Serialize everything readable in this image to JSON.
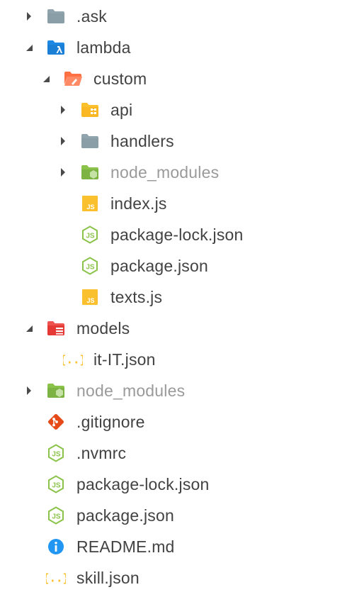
{
  "tree": {
    "items": [
      {
        "name": ".ask",
        "depth": 0,
        "twisty": "collapsed",
        "icon": "folder-grey-icon",
        "dim": false
      },
      {
        "name": "lambda",
        "depth": 0,
        "twisty": "expanded",
        "icon": "folder-lambda-blue-icon",
        "dim": false
      },
      {
        "name": "custom",
        "depth": 1,
        "twisty": "expanded",
        "icon": "folder-open-orange-icon",
        "dim": false
      },
      {
        "name": "api",
        "depth": 2,
        "twisty": "collapsed",
        "icon": "folder-api-yellow-icon",
        "dim": false
      },
      {
        "name": "handlers",
        "depth": 2,
        "twisty": "collapsed",
        "icon": "folder-grey-icon",
        "dim": false
      },
      {
        "name": "node_modules",
        "depth": 2,
        "twisty": "collapsed",
        "icon": "folder-node-green-icon",
        "dim": true
      },
      {
        "name": "index.js",
        "depth": 2,
        "twisty": "none",
        "icon": "javascript-file-icon",
        "dim": false
      },
      {
        "name": "package-lock.json",
        "depth": 2,
        "twisty": "none",
        "icon": "nodejs-file-icon",
        "dim": false
      },
      {
        "name": "package.json",
        "depth": 2,
        "twisty": "none",
        "icon": "nodejs-file-icon",
        "dim": false
      },
      {
        "name": "texts.js",
        "depth": 2,
        "twisty": "none",
        "icon": "javascript-file-icon",
        "dim": false
      },
      {
        "name": "models",
        "depth": 0,
        "twisty": "expanded",
        "icon": "folder-models-red-icon",
        "dim": false
      },
      {
        "name": "it-IT.json",
        "depth": 1,
        "twisty": "none",
        "icon": "json-file-icon",
        "dim": false
      },
      {
        "name": "node_modules",
        "depth": 0,
        "twisty": "collapsed",
        "icon": "folder-node-green-icon",
        "dim": true
      },
      {
        "name": ".gitignore",
        "depth": 0,
        "twisty": "none",
        "icon": "git-file-icon",
        "dim": false
      },
      {
        "name": ".nvmrc",
        "depth": 0,
        "twisty": "none",
        "icon": "nodejs-file-icon",
        "dim": false
      },
      {
        "name": "package-lock.json",
        "depth": 0,
        "twisty": "none",
        "icon": "nodejs-file-icon",
        "dim": false
      },
      {
        "name": "package.json",
        "depth": 0,
        "twisty": "none",
        "icon": "nodejs-file-icon",
        "dim": false
      },
      {
        "name": "README.md",
        "depth": 0,
        "twisty": "none",
        "icon": "info-file-icon",
        "dim": false
      },
      {
        "name": "skill.json",
        "depth": 0,
        "twisty": "none",
        "icon": "json-file-icon",
        "dim": false
      }
    ]
  },
  "colors": {
    "text": "#424242",
    "text_dim": "#9a9a9a",
    "folder_grey": "#90a4ae",
    "folder_blue": "#1e88e5",
    "folder_orange": "#ff7043",
    "folder_yellow": "#fbc02d",
    "folder_green": "#8bc34a",
    "folder_red": "#ef5350",
    "js_yellow": "#fbc02d",
    "node_green": "#8bc34a",
    "json_yellow": "#fbc02d",
    "git_orange": "#e64a19",
    "info_blue": "#2196f3",
    "twisty": "#4a4a4a"
  }
}
